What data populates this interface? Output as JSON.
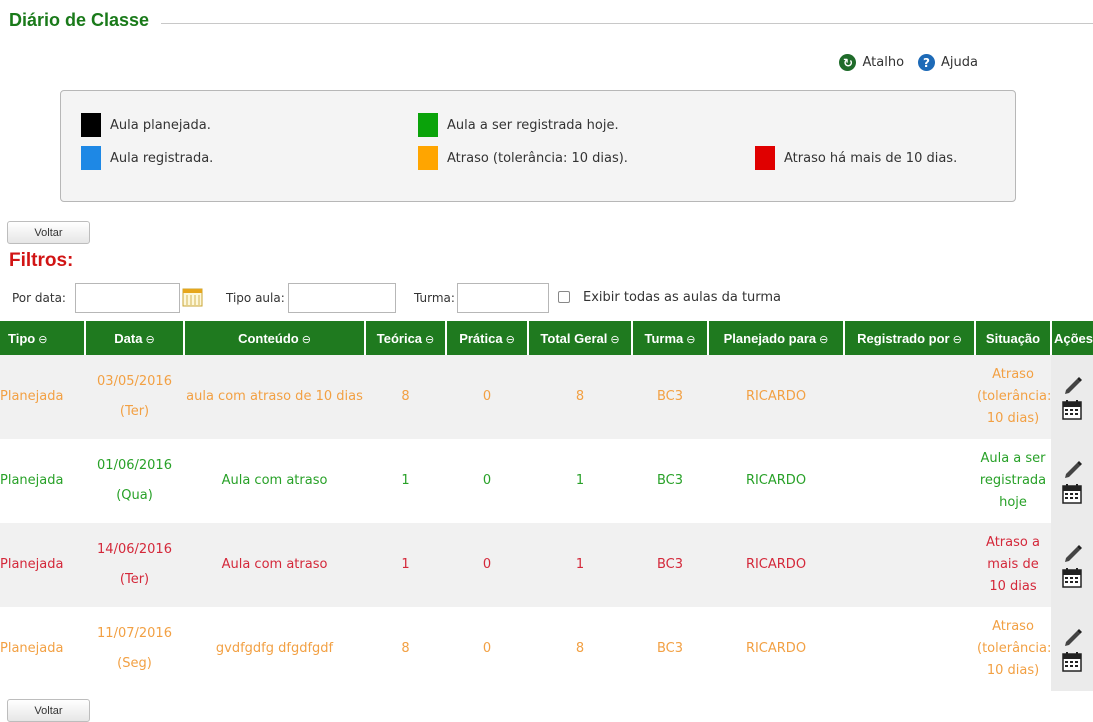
{
  "page": {
    "title": "Diário de Classe",
    "links": {
      "atalho": "Atalho",
      "ajuda": "Ajuda",
      "atalho_icon": "shortcut-icon",
      "ajuda_icon": "help-icon"
    },
    "voltar": "Voltar"
  },
  "legend": [
    {
      "label": "Aula planejada.",
      "color": "#000000"
    },
    {
      "label": "Aula registrada.",
      "color": "#1e88e5"
    },
    {
      "label": "Aula a ser registrada hoje.",
      "color": "#0aa30a"
    },
    {
      "label": "Atraso (tolerância: 10 dias).",
      "color": "#ffa500"
    },
    {
      "label": "Atraso há mais de 10 dias.",
      "color": "#e00000"
    }
  ],
  "filters": {
    "title": "Filtros:",
    "por_data_label": "Por data:",
    "por_data_value": "",
    "tipo_aula_label": "Tipo aula:",
    "tipo_aula_value": "",
    "turma_label": "Turma:",
    "turma_value": "",
    "exibir_label": "Exibir todas as aulas da turma",
    "exibir_checked": false
  },
  "table": {
    "headers": [
      "Tipo",
      "Data",
      "Conteúdo",
      "Teórica",
      "Prática",
      "Total Geral",
      "Turma",
      "Planejado para",
      "Registrado por",
      "Situação",
      "Ações"
    ],
    "sort_icon": "sort-icon",
    "rows": [
      {
        "tipo": "Planejada",
        "data": "03/05/2016",
        "dia": "(Ter)",
        "conteudo": "aula com atraso de 10 dias",
        "teorica": "8",
        "pratica": "0",
        "total": "8",
        "turma": "BC3",
        "planejado": "RICARDO",
        "registrado": "",
        "situacao": "Atraso (tolerância: 10 dias)",
        "color": "#f2a043"
      },
      {
        "tipo": "Planejada",
        "data": "01/06/2016",
        "dia": "(Qua)",
        "conteudo": "Aula com atraso",
        "teorica": "1",
        "pratica": "0",
        "total": "1",
        "turma": "BC3",
        "planejado": "RICARDO",
        "registrado": "",
        "situacao": "Aula a ser registrada hoje",
        "color": "#28a128"
      },
      {
        "tipo": "Planejada",
        "data": "14/06/2016",
        "dia": "(Ter)",
        "conteudo": "Aula com atraso",
        "teorica": "1",
        "pratica": "0",
        "total": "1",
        "turma": "BC3",
        "planejado": "RICARDO",
        "registrado": "",
        "situacao": "Atraso a mais de 10 dias",
        "color": "#d4283a"
      },
      {
        "tipo": "Planejada",
        "data": "11/07/2016",
        "dia": "(Seg)",
        "conteudo": "gvdfgdfg dfgdfgdf",
        "teorica": "8",
        "pratica": "0",
        "total": "8",
        "turma": "BC3",
        "planejado": "RICARDO",
        "registrado": "",
        "situacao": "Atraso (tolerância: 10 dias)",
        "color": "#f2a043"
      }
    ]
  },
  "colors": {
    "accent_green": "#1f7a1f",
    "filtros_red": "#d11414"
  }
}
